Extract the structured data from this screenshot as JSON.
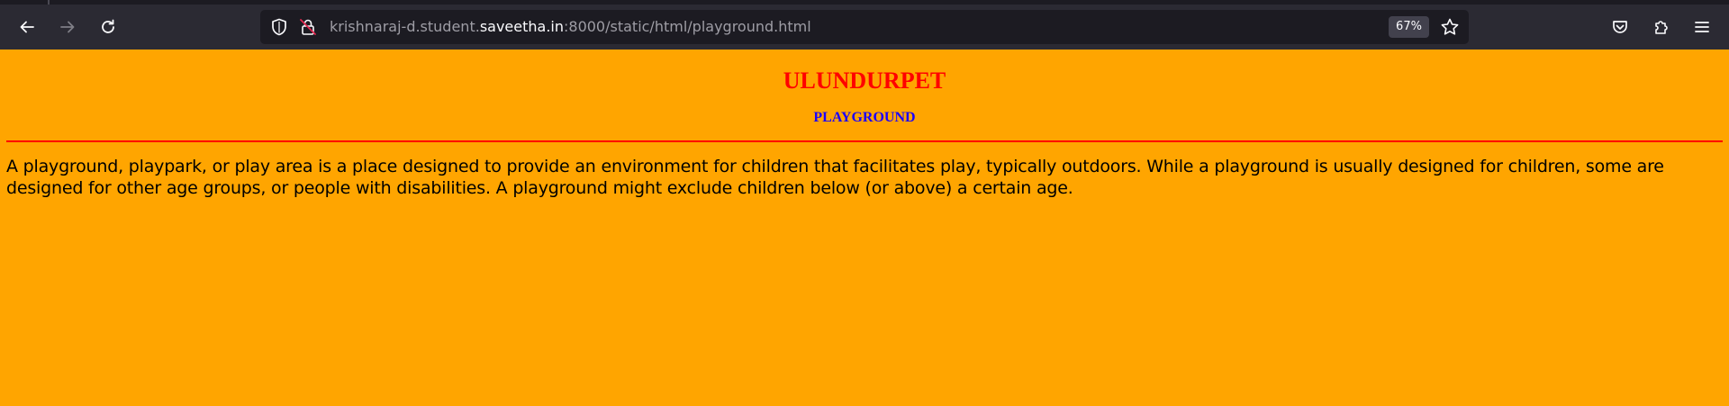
{
  "browser": {
    "url_prefix": "krishnaraj-d.student.",
    "url_domain": "saveetha.in",
    "url_suffix": ":8000/static/html/playground.html",
    "zoom_level": "67%",
    "icons": {
      "back": "arrow-left-icon",
      "forward": "arrow-right-icon",
      "reload": "reload-icon",
      "tracking_protection": "shield-icon",
      "insecure": "lock-slash-icon",
      "bookmark": "star-icon",
      "pocket": "pocket-icon",
      "extensions": "puzzle-icon",
      "menu": "hamburger-menu-icon"
    }
  },
  "page": {
    "heading": "ULUNDURPET",
    "subheading": "PLAYGROUND",
    "paragraph": "A playground, playpark, or play area is a place designed to provide an environment for children that facilitates play, typically outdoors. While a playground is usually designed for children, some are designed for other age groups, or people with disabilities. A playground might exclude children below (or above) a certain age.",
    "colors": {
      "background": "#ffa500",
      "heading": "#ff0000",
      "subheading": "#1a00ff",
      "rule": "#ff0000"
    }
  }
}
